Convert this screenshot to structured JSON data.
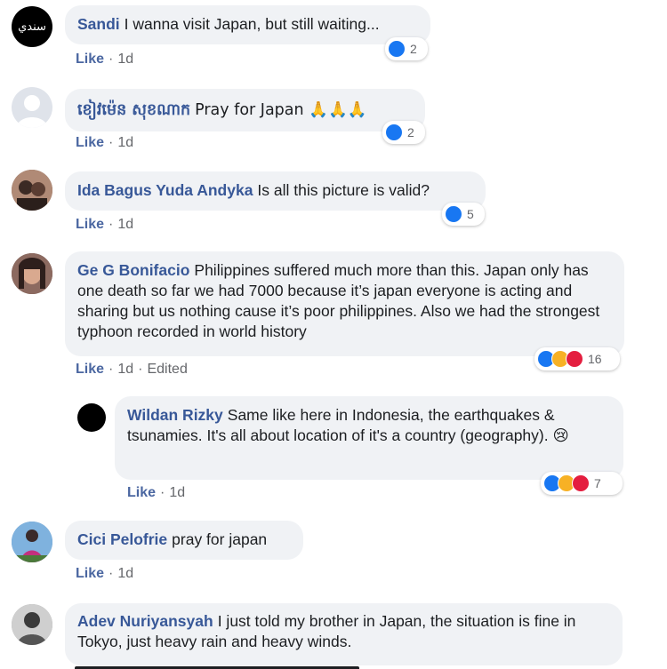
{
  "comments": [
    {
      "author": "Sandi",
      "text": "I wanna visit Japan, but still waiting...",
      "like": "Like",
      "time": "1d",
      "reactions": "2",
      "avatar_text": "سندي"
    },
    {
      "author": "ខៀវម៉េន សុខណាក",
      "text": "Pray for Japan 🙏🙏🙏",
      "like": "Like",
      "time": "1d",
      "reactions": "2"
    },
    {
      "author": "Ida Bagus Yuda Andyka",
      "text": "Is all this picture is valid?",
      "like": "Like",
      "time": "1d",
      "reactions": "5"
    },
    {
      "author": "Ge G Bonifacio",
      "text": "Philippines suffered much more than this. Japan only has one death so far we had 7000 because it’s japan everyone is acting and sharing but us nothing cause it’s poor philippines. Also we had the strongest typhoon recorded in world history",
      "like": "Like",
      "time": "1d",
      "edited": "Edited",
      "reactions": "16"
    },
    {
      "author": "Wildan Rizky",
      "text": "Same like here in Indonesia, the earthquakes & tsunamies. It's all about location of it's a country (geography). 😢",
      "like": "Like",
      "time": "1d",
      "reactions": "7"
    },
    {
      "author": "Cici Pelofrie",
      "text": "pray for japan",
      "like": "Like",
      "time": "1d"
    },
    {
      "author": "Adev Nuriyansyah",
      "text": "I just told my brother in Japan, the situation is fine in Tokyo, just heavy rain and heavy winds."
    }
  ],
  "separator": "·",
  "colors": {
    "author": "#385898",
    "bubble": "#f0f2f5",
    "like_reaction": "#1877f2",
    "sad_reaction": "#f7b125",
    "love_reaction": "#e41e3f"
  }
}
